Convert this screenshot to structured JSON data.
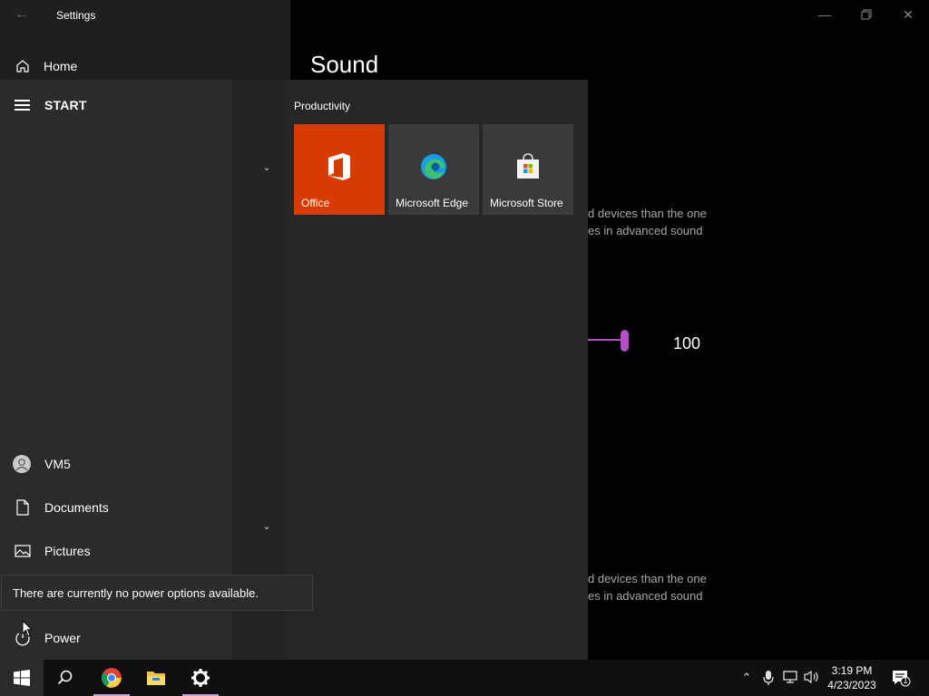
{
  "window": {
    "title": "Settings",
    "back_icon": "back-arrow-icon",
    "home_label": "Home",
    "page_title": "Sound",
    "controls": [
      "minimize-icon",
      "restore-icon",
      "close-icon"
    ]
  },
  "background": {
    "text_block_1": [
      "d devices than the one",
      "es in advanced sound"
    ],
    "text_block_2": [
      "d devices than the one",
      "es in advanced sound"
    ],
    "volume_value": "100",
    "volume_level": 1.0,
    "accent_color": "#b14fc5"
  },
  "start_menu": {
    "header": "START",
    "group_label": "Productivity",
    "tiles": [
      {
        "label": "Office",
        "icon": "office-icon",
        "color": "#d83b01"
      },
      {
        "label": "Microsoft Edge",
        "icon": "edge-icon",
        "color": "#3a3a3a"
      },
      {
        "label": "Microsoft Store",
        "icon": "store-icon",
        "color": "#3a3a3a"
      }
    ],
    "rail": {
      "user": "VM5",
      "documents": "Documents",
      "pictures": "Pictures",
      "power": "Power"
    },
    "tooltip": "There are currently no power options available."
  },
  "taskbar": {
    "apps": [
      "windows-start-icon",
      "search-icon",
      "chrome-icon",
      "file-explorer-icon",
      "settings-gear-icon"
    ],
    "tray": [
      "chevron-up-icon",
      "microphone-icon",
      "network-icon",
      "volume-icon"
    ],
    "time": "3:19 PM",
    "date": "4/23/2023",
    "notification_count": "1"
  }
}
